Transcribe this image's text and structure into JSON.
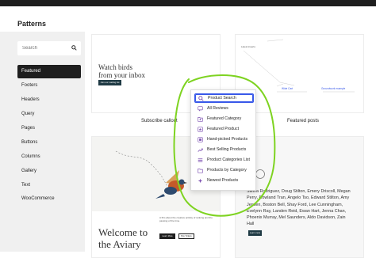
{
  "modal": {
    "title": "Patterns"
  },
  "search": {
    "placeholder": "Search"
  },
  "categories": [
    {
      "label": "Featured",
      "active": true
    },
    {
      "label": "Footers"
    },
    {
      "label": "Headers"
    },
    {
      "label": "Query"
    },
    {
      "label": "Pages"
    },
    {
      "label": "Buttons"
    },
    {
      "label": "Columns"
    },
    {
      "label": "Gallery"
    },
    {
      "label": "Text"
    },
    {
      "label": "WooCommerce"
    }
  ],
  "patterns": {
    "subscribe": {
      "heading_line1": "Watch birds",
      "heading_line2": "from your inbox",
      "button": "Join our mailing list",
      "caption": "Subscribe callout"
    },
    "featured_posts": {
      "label": "Latest inserts",
      "link1": "Wide Cart",
      "link2": "Groundwork example",
      "caption": "Featured posts"
    },
    "aviary": {
      "heading_line1": "Welcome to",
      "heading_line2": "the Aviary",
      "small_text": "A film about the creative activity of ranking and the passing of the time.",
      "btn1": "Learn More",
      "btn2": "Buy Tickets"
    },
    "names": {
      "text": "Sleina Rodriguez, Doug Stilton, Emery Driscoll, Megan Perry, Rowland Tran, Angelo Tso, Edward Stilton, Amy Jensen, Boston Bell, Shay Ford, Lee Cunningham, Evelynn Ray, Landen Reid, Ewan Hart, Jenna Chan, Phoenix Murray, Mel Saunders, Aldo Davidson, Zain Hall",
      "button": "Learn more"
    }
  },
  "dropdown": {
    "items": [
      {
        "label": "Product Search",
        "icon": "search-icon",
        "selected": true
      },
      {
        "label": "All Reviews",
        "icon": "comment-icon"
      },
      {
        "label": "Featured Category",
        "icon": "folder-star-icon"
      },
      {
        "label": "Featured Product",
        "icon": "star-icon"
      },
      {
        "label": "Hand-picked Products",
        "icon": "hand-picked-icon"
      },
      {
        "label": "Best Selling Products",
        "icon": "trend-icon"
      },
      {
        "label": "Product Categories List",
        "icon": "list-icon"
      },
      {
        "label": "Products by Category",
        "icon": "folder-icon"
      },
      {
        "label": "Newest Products",
        "icon": "sparkle-icon"
      }
    ]
  },
  "colors": {
    "accent": "#3858e9",
    "woo_purple": "#7f54b3",
    "annotation_green": "#7ed321",
    "sidebar_active": "#1e1e1e"
  }
}
